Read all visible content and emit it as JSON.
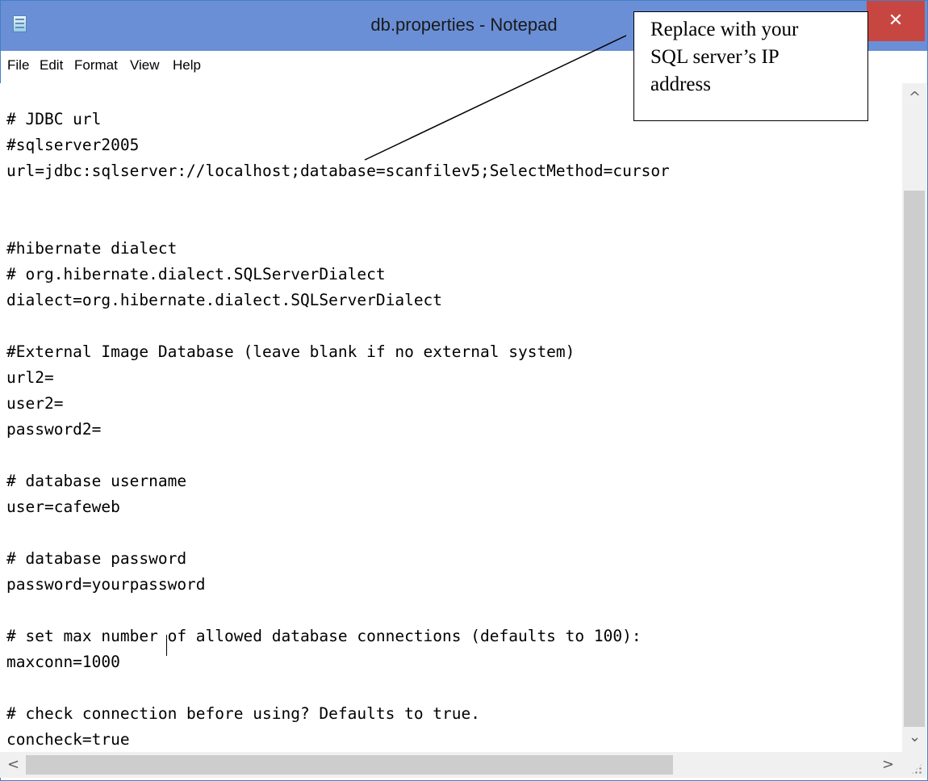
{
  "window": {
    "title": "db.properties - Notepad",
    "close_symbol": "✕"
  },
  "menu": {
    "items": [
      "File",
      "Edit",
      "Format",
      "View",
      "Help"
    ]
  },
  "editor": {
    "lines": [
      "# JDBC url",
      "#sqlserver2005",
      "url=jdbc:sqlserver://localhost;database=scanfilev5;SelectMethod=cursor",
      "",
      "",
      "#hibernate dialect",
      "# org.hibernate.dialect.SQLServerDialect",
      "dialect=org.hibernate.dialect.SQLServerDialect",
      "",
      "#External Image Database (leave blank if no external system)",
      "url2=",
      "user2=",
      "password2=",
      "",
      "# database username",
      "user=cafeweb",
      "",
      "# database password",
      "password=yourpassword",
      "",
      "# set max number of allowed database connections (defaults to 100):",
      "maxconn=1000",
      "",
      "# check connection before using? Defaults to true.",
      "concheck=true"
    ]
  },
  "scrollbars": {
    "up_arrow": "^",
    "down_arrow": "⌄",
    "left_arrow": "<",
    "right_arrow": ">"
  },
  "annotation": {
    "lines": [
      "Replace with your",
      "SQL server’s IP",
      "address"
    ]
  }
}
